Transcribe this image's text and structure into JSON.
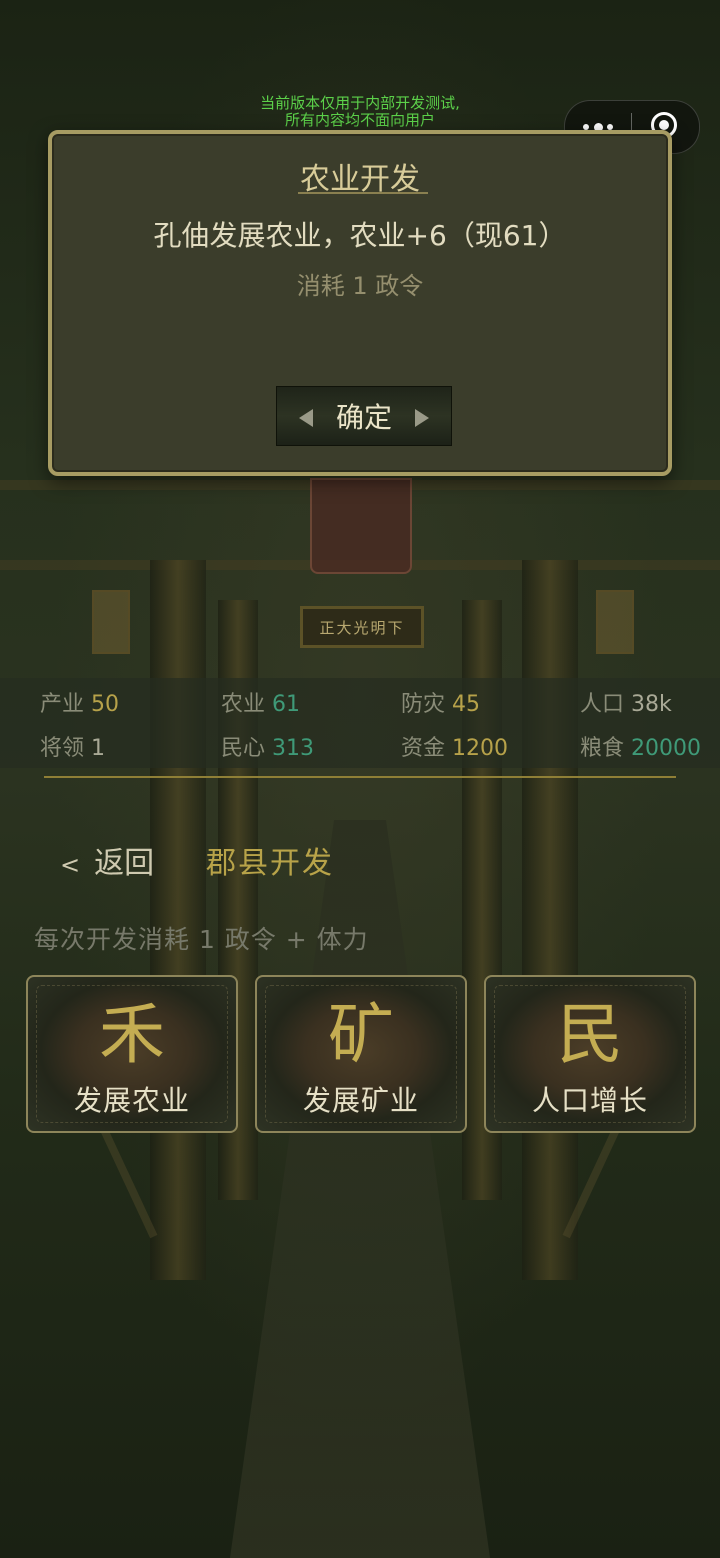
{
  "watermark": {
    "line1": "当前版本仅用于内部开发测试,",
    "line2": "所有内容均不面向用户"
  },
  "scene": {
    "plaque_text": "正大光明下"
  },
  "dialog": {
    "title": "农业开发",
    "message": "孔伷发展农业，农业+6（现61）",
    "cost": "消耗 1 政令",
    "confirm_label": "确定"
  },
  "stats": {
    "row1": [
      {
        "label": "产业",
        "value": "50",
        "color": "#b7a24a"
      },
      {
        "label": "农业",
        "value": "61",
        "color": "#3f9a78"
      },
      {
        "label": "防灾",
        "value": "45",
        "color": "#b7a24a"
      },
      {
        "label": "人口",
        "value": "38k",
        "color": "#a9a996"
      }
    ],
    "row2": [
      {
        "label": "将领",
        "value": "1",
        "color": "#a9a996"
      },
      {
        "label": "民心",
        "value": "313",
        "color": "#3f9a78"
      },
      {
        "label": "资金",
        "value": "1200",
        "color": "#b7a24a"
      },
      {
        "label": "粮食",
        "value": "20000",
        "color": "#3f9a78"
      }
    ]
  },
  "nav": {
    "back_chevron": "<",
    "back_label": "返回",
    "title": "郡县开发"
  },
  "hint": "每次开发消耗 1 政令 + 体力",
  "actions": [
    {
      "glyph": "禾",
      "label": "发展农业"
    },
    {
      "glyph": "矿",
      "label": "发展矿业"
    },
    {
      "glyph": "民",
      "label": "人口增长"
    }
  ],
  "colors": {
    "accent_gold": "#b8a349",
    "teal": "#3f9a78",
    "dialog_border": "#a79c63"
  }
}
